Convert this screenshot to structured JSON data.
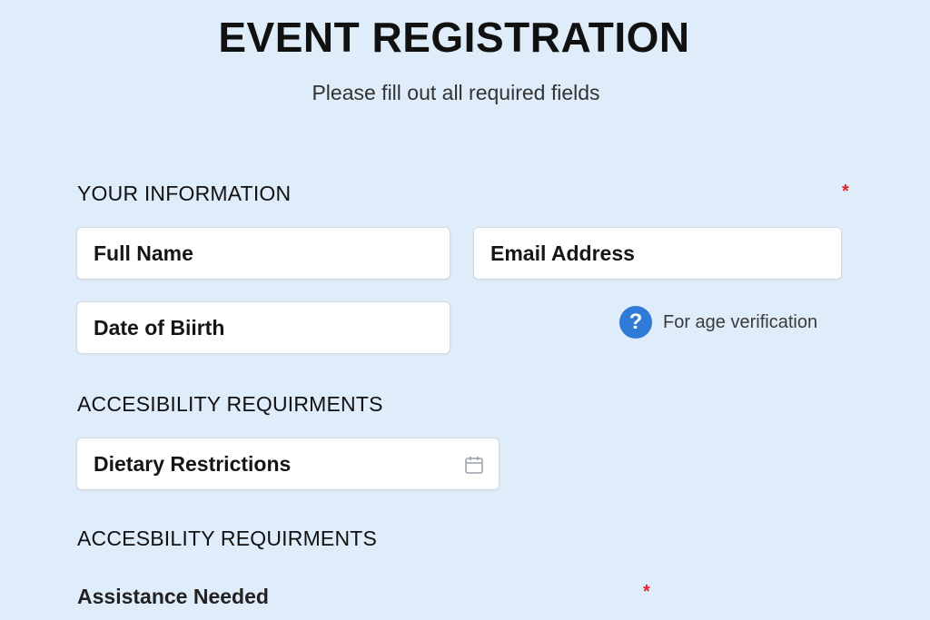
{
  "header": {
    "title": "EVENT REGISTRATION",
    "subtitle": "Please fill out all required fields"
  },
  "sections": {
    "your_information": {
      "heading": "YOUR INFORMATION",
      "required_mark": "*",
      "fields": {
        "full_name": "Full Name",
        "email": "Email Address",
        "dob": "Date of Biirth"
      },
      "help": {
        "icon": "question-circle-icon",
        "glyph": "?",
        "text": "For age verification"
      }
    },
    "accessibility_1": {
      "heading": "ACCESIBILITY REQUIRMENTS",
      "fields": {
        "dietary": "Dietary Restrictions"
      },
      "field_icon": "calendar-icon"
    },
    "accessibility_2": {
      "heading": "ACCESBILITY REQUIRMENTS",
      "assistance_label": "Assistance Needed",
      "required_mark": "*"
    }
  },
  "colors": {
    "background": "#dfecf9",
    "required": "#e0242a",
    "help_icon": "#2f7bd8",
    "field_border": "#cfd9e4"
  }
}
